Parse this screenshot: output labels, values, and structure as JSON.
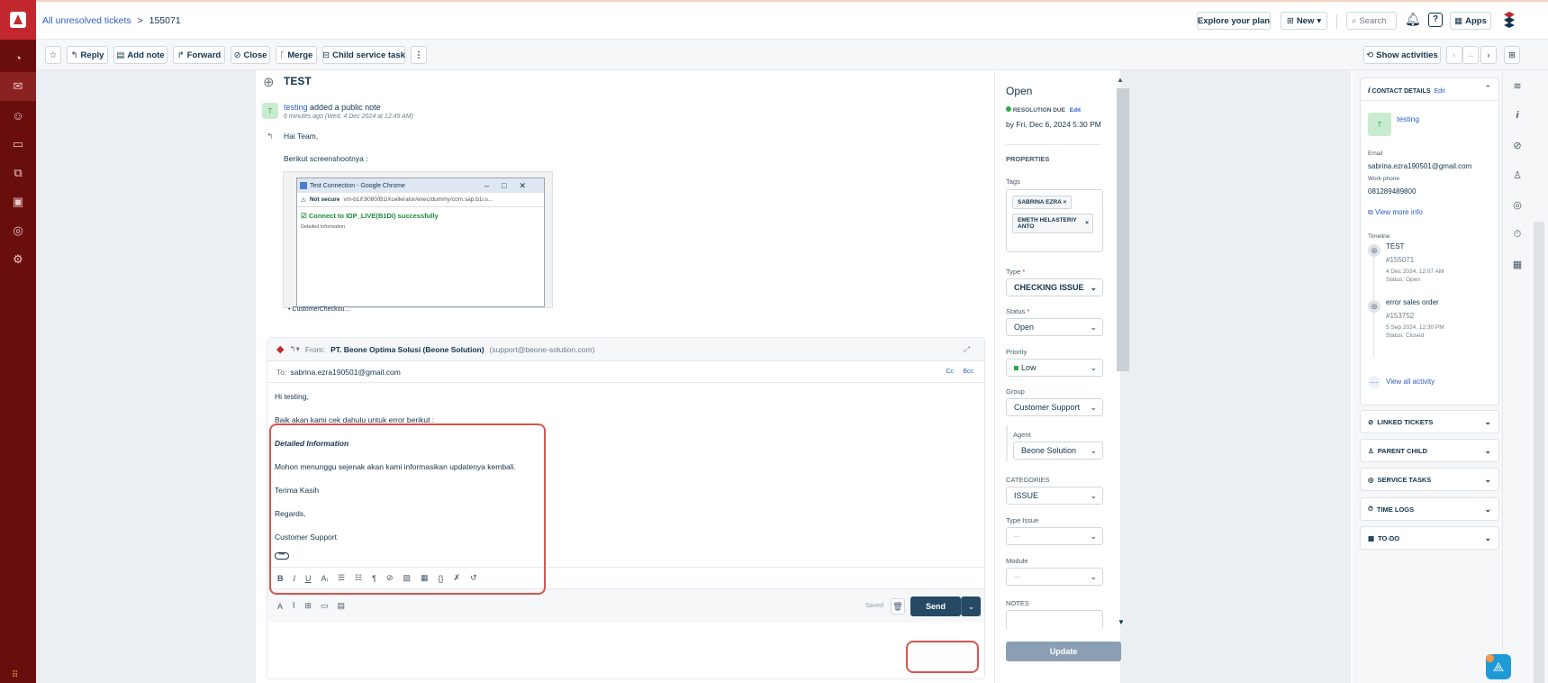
{
  "breadcrumb": {
    "parent": "All unresolved tickets",
    "separator": ">",
    "current": "155071"
  },
  "topbar": {
    "explore": "Explore your plan",
    "new": "New",
    "search": "Search",
    "apps": "Apps"
  },
  "toolbar": {
    "reply": "Reply",
    "add_note": "Add note",
    "forward": "Forward",
    "close": "Close",
    "merge": "Merge",
    "child_task": "Child service task",
    "more": "⋮",
    "show_activities": "Show activities"
  },
  "ticket": {
    "title": "TEST",
    "author": "testing",
    "action": "added a public note",
    "time": "6 minutes ago (Wed, 4 Dec 2024 at 12:49 AM)",
    "greeting": "Hai Team,",
    "line": "Berikut screenshootnya :"
  },
  "popup": {
    "title": "Test Connection - Google Chrome",
    "not_secure": "Not secure",
    "url": "vm-b1if:8080/B1iXcellerator/exec/dummy/com.sap.b1i.s...",
    "message": "Connect to IDP_LIVE(B1DI) successfully",
    "detail": "Detailed Information",
    "bullet": "CustomerCheckou..."
  },
  "reply": {
    "from_label": "From:",
    "from_name": "PT. Beone Optima Solusi (Beone Solution)",
    "from_email": "(support@beone-solution.com)",
    "to_label": "To:",
    "to_email": "sabrina.ezra190501@gmail.com",
    "cc": "Cc",
    "bcc": "Bcc",
    "body": [
      "Hi testing,",
      "Baik akan kami cek dahulu untuk error berikut :",
      "Detailed Information",
      "Mohon menunggu sejenak akan kami informasikan updatenya kembali.",
      "Terima Kasih",
      "Regards,",
      "Customer Support"
    ],
    "saved": "Saved",
    "send": "Send"
  },
  "properties": {
    "status_title": "Open",
    "resolution_due": "RESOLUTION DUE",
    "edit": "Edit",
    "due_date": "by Fri, Dec 6, 2024 5:30 PM",
    "heading": "PROPERTIES",
    "tags_label": "Tags",
    "tags": [
      "SABRINA EZRA",
      "EMETH HELASTERIY ANTO"
    ],
    "type_label": "Type",
    "type_value": "CHECKING ISSUE",
    "status_label": "Status",
    "status_value": "Open",
    "priority_label": "Priority",
    "priority_value": "Low",
    "group_label": "Group",
    "group_value": "Customer Support",
    "agent_label": "Agent",
    "agent_value": "Beone Solution",
    "categories_label": "CATEGORIES",
    "categories_value": "ISSUE",
    "type_issue_label": "Type Issue",
    "type_issue_value": "--",
    "module_label": "Module",
    "module_value": "--",
    "notes_label": "NOTES",
    "update": "Update"
  },
  "contact": {
    "heading": "CONTACT DETAILS",
    "edit": "Edit",
    "name": "testing",
    "avatar": "T",
    "email_label": "Email",
    "email": "sabrina.ezra190501@gmail.com",
    "phone_label": "Work phone",
    "phone": "081289489800",
    "view_more": "View more info",
    "timeline_label": "Timeline",
    "timeline": [
      {
        "title": "TEST",
        "id": "#155071",
        "date": "4 Dec 2024, 12:07 AM",
        "status": "Status: Open"
      },
      {
        "title": "error sales order",
        "id": "#153752",
        "date": "5 Sep 2024, 12:30 PM",
        "status": "Status: Closed"
      }
    ],
    "view_all": "View all activity"
  },
  "accordions": [
    "LINKED TICKETS",
    "PARENT CHILD",
    "SERVICE TASKS",
    "TIME LOGS",
    "TO-DO"
  ]
}
